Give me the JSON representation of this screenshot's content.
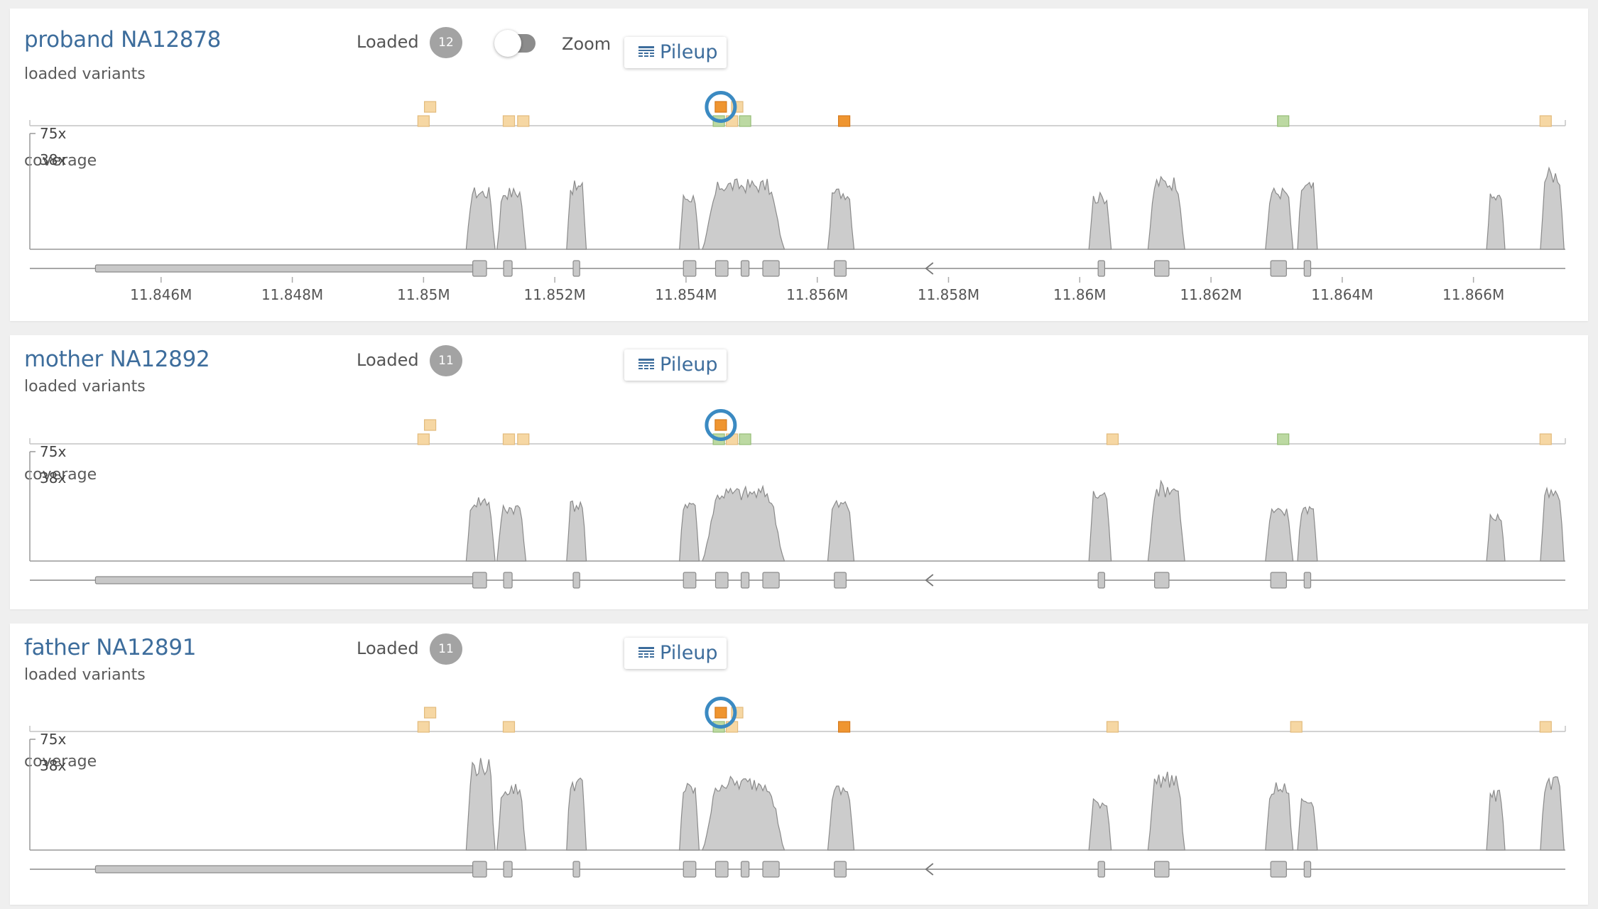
{
  "colors": {
    "title": "#3d6d9c",
    "variant_light": "#f6d7a3",
    "variant_dark": "#ef9530",
    "variant_green": "#bcd9a2",
    "highlight_ring": "#3b8ac2",
    "coverage_fill": "#cccccc",
    "exon_fill": "#c8c8c8"
  },
  "coverage_scale": {
    "max_label": "75x",
    "mid_label": "38x"
  },
  "axis": {
    "start": 11844000,
    "end": 11867400,
    "labels": [
      "11.846M",
      "11.848M",
      "11.85M",
      "11.852M",
      "11.854M",
      "11.856M",
      "11.858M",
      "11.86M",
      "11.862M",
      "11.864M",
      "11.866M"
    ],
    "values": [
      11846000,
      11848000,
      11850000,
      11852000,
      11854000,
      11856000,
      11858000,
      11860000,
      11862000,
      11864000,
      11866000
    ]
  },
  "gene_model": {
    "strand": "reverse",
    "utr": {
      "start": 11845000,
      "end": 11850800
    },
    "exons": [
      {
        "start": 11850750,
        "end": 11850960
      },
      {
        "start": 11851220,
        "end": 11851350
      },
      {
        "start": 11852280,
        "end": 11852380
      },
      {
        "start": 11853960,
        "end": 11854150
      },
      {
        "start": 11854450,
        "end": 11854640
      },
      {
        "start": 11854840,
        "end": 11854960
      },
      {
        "start": 11855170,
        "end": 11855420
      },
      {
        "start": 11856260,
        "end": 11856440
      },
      {
        "start": 11860280,
        "end": 11860380
      },
      {
        "start": 11861140,
        "end": 11861360
      },
      {
        "start": 11862910,
        "end": 11863150
      },
      {
        "start": 11863420,
        "end": 11863520
      }
    ]
  },
  "samples": [
    {
      "name": "proband NA12878",
      "loaded_label": "Loaded",
      "loaded_count": "12",
      "has_zoom": true,
      "zoom_label": "Zoom",
      "pileup_label": "Pileup",
      "variants_label": "loaded variants",
      "coverage_label": "coverage",
      "variants": [
        {
          "pos": 11850100,
          "row": 1,
          "type": "light"
        },
        {
          "pos": 11850000,
          "row": 0,
          "type": "light"
        },
        {
          "pos": 11851300,
          "row": 0,
          "type": "light"
        },
        {
          "pos": 11851520,
          "row": 0,
          "type": "light"
        },
        {
          "pos": 11854500,
          "row": 0,
          "type": "green"
        },
        {
          "pos": 11854700,
          "row": 0,
          "type": "light"
        },
        {
          "pos": 11854900,
          "row": 0,
          "type": "green"
        },
        {
          "pos": 11854780,
          "row": 1,
          "type": "light"
        },
        {
          "pos": 11854530,
          "row": 1,
          "type": "dark",
          "selected": true
        },
        {
          "pos": 11856410,
          "row": 0,
          "type": "dark"
        },
        {
          "pos": 11863100,
          "row": 0,
          "type": "green"
        },
        {
          "pos": 11867100,
          "row": 0,
          "type": "light"
        }
      ],
      "coverage_peaks": [
        {
          "start": 11850650,
          "end": 11851090,
          "depth": 0.55
        },
        {
          "start": 11851120,
          "end": 11851560,
          "depth": 0.55
        },
        {
          "start": 11852180,
          "end": 11852480,
          "depth": 0.6
        },
        {
          "start": 11853900,
          "end": 11854200,
          "depth": 0.5
        },
        {
          "start": 11854250,
          "end": 11855500,
          "depth": 0.62
        },
        {
          "start": 11856160,
          "end": 11856560,
          "depth": 0.55
        },
        {
          "start": 11860140,
          "end": 11860480,
          "depth": 0.5
        },
        {
          "start": 11861040,
          "end": 11861600,
          "depth": 0.65
        },
        {
          "start": 11862830,
          "end": 11863250,
          "depth": 0.55
        },
        {
          "start": 11863320,
          "end": 11863620,
          "depth": 0.6
        },
        {
          "start": 11866200,
          "end": 11866480,
          "depth": 0.5
        },
        {
          "start": 11867020,
          "end": 11867380,
          "depth": 0.72
        }
      ]
    },
    {
      "name": "mother NA12892",
      "loaded_label": "Loaded",
      "loaded_count": "11",
      "has_zoom": false,
      "pileup_label": "Pileup",
      "variants_label": "loaded variants",
      "coverage_label": "coverage",
      "variants": [
        {
          "pos": 11850100,
          "row": 1,
          "type": "light"
        },
        {
          "pos": 11850000,
          "row": 0,
          "type": "light"
        },
        {
          "pos": 11851300,
          "row": 0,
          "type": "light"
        },
        {
          "pos": 11851520,
          "row": 0,
          "type": "light"
        },
        {
          "pos": 11854500,
          "row": 0,
          "type": "green"
        },
        {
          "pos": 11854700,
          "row": 0,
          "type": "light"
        },
        {
          "pos": 11854900,
          "row": 0,
          "type": "green"
        },
        {
          "pos": 11854530,
          "row": 1,
          "type": "dark",
          "selected": true
        },
        {
          "pos": 11860500,
          "row": 0,
          "type": "light"
        },
        {
          "pos": 11863100,
          "row": 0,
          "type": "green"
        },
        {
          "pos": 11867100,
          "row": 0,
          "type": "light"
        }
      ],
      "coverage_peaks": [
        {
          "start": 11850650,
          "end": 11851090,
          "depth": 0.62
        },
        {
          "start": 11851120,
          "end": 11851560,
          "depth": 0.55
        },
        {
          "start": 11852180,
          "end": 11852480,
          "depth": 0.58
        },
        {
          "start": 11853900,
          "end": 11854200,
          "depth": 0.6
        },
        {
          "start": 11854250,
          "end": 11855500,
          "depth": 0.7
        },
        {
          "start": 11856160,
          "end": 11856560,
          "depth": 0.58
        },
        {
          "start": 11860140,
          "end": 11860480,
          "depth": 0.68
        },
        {
          "start": 11861040,
          "end": 11861600,
          "depth": 0.75
        },
        {
          "start": 11862830,
          "end": 11863250,
          "depth": 0.5
        },
        {
          "start": 11863320,
          "end": 11863620,
          "depth": 0.55
        },
        {
          "start": 11866200,
          "end": 11866480,
          "depth": 0.45
        },
        {
          "start": 11867020,
          "end": 11867380,
          "depth": 0.68
        }
      ]
    },
    {
      "name": "father NA12891",
      "loaded_label": "Loaded",
      "loaded_count": "11",
      "has_zoom": false,
      "pileup_label": "Pileup",
      "variants_label": "loaded variants",
      "coverage_label": "coverage",
      "variants": [
        {
          "pos": 11850100,
          "row": 1,
          "type": "light"
        },
        {
          "pos": 11850000,
          "row": 0,
          "type": "light"
        },
        {
          "pos": 11851300,
          "row": 0,
          "type": "light"
        },
        {
          "pos": 11854500,
          "row": 0,
          "type": "green"
        },
        {
          "pos": 11854700,
          "row": 0,
          "type": "light"
        },
        {
          "pos": 11854780,
          "row": 1,
          "type": "light"
        },
        {
          "pos": 11854530,
          "row": 1,
          "type": "dark",
          "selected": true
        },
        {
          "pos": 11856410,
          "row": 0,
          "type": "dark"
        },
        {
          "pos": 11860500,
          "row": 0,
          "type": "light"
        },
        {
          "pos": 11863300,
          "row": 0,
          "type": "light"
        },
        {
          "pos": 11867100,
          "row": 0,
          "type": "light"
        }
      ],
      "coverage_peaks": [
        {
          "start": 11850650,
          "end": 11851090,
          "depth": 0.85
        },
        {
          "start": 11851120,
          "end": 11851560,
          "depth": 0.62
        },
        {
          "start": 11852180,
          "end": 11852480,
          "depth": 0.68
        },
        {
          "start": 11853900,
          "end": 11854200,
          "depth": 0.62
        },
        {
          "start": 11854250,
          "end": 11855500,
          "depth": 0.68
        },
        {
          "start": 11856160,
          "end": 11856560,
          "depth": 0.6
        },
        {
          "start": 11860140,
          "end": 11860480,
          "depth": 0.48
        },
        {
          "start": 11861040,
          "end": 11861600,
          "depth": 0.72
        },
        {
          "start": 11862830,
          "end": 11863250,
          "depth": 0.62
        },
        {
          "start": 11863320,
          "end": 11863620,
          "depth": 0.5
        },
        {
          "start": 11866200,
          "end": 11866480,
          "depth": 0.55
        },
        {
          "start": 11867020,
          "end": 11867380,
          "depth": 0.68
        }
      ]
    }
  ]
}
